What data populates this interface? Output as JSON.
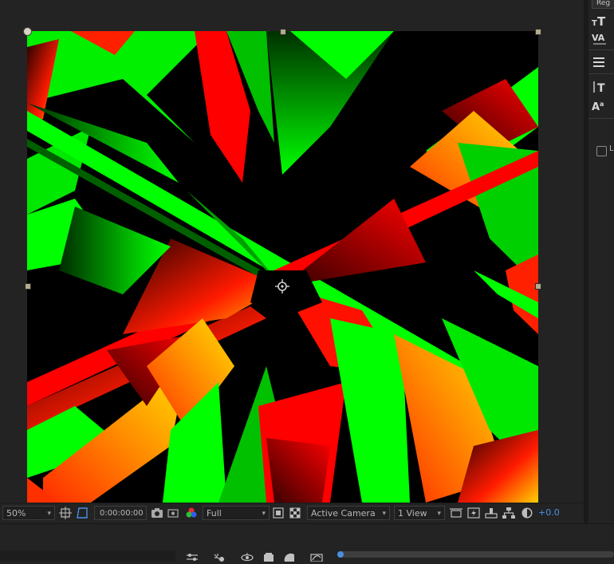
{
  "viewer": {
    "magnification": "50%",
    "timecode": "0:00:00:00",
    "resolution": "Full",
    "camera": "Active Camera",
    "views": "1 View",
    "exposure": "+0.0"
  },
  "character_panel": {
    "region_label": "Reg",
    "checkbox_label": "L"
  },
  "colors": {
    "panel_bg": "#232323",
    "accent_blue": "#4a8fe3",
    "fractal_green": "#00ff00",
    "fractal_red": "#ff0000",
    "fractal_yellow": "#ffd000"
  },
  "icons": {
    "snapshot": "camera-icon",
    "channels": "rgb-channels-icon",
    "transparency": "transparency-grid-icon",
    "region": "region-of-interest-icon",
    "fast_previews": "fast-previews-icon",
    "reset_exposure": "reset-exposure-icon"
  }
}
